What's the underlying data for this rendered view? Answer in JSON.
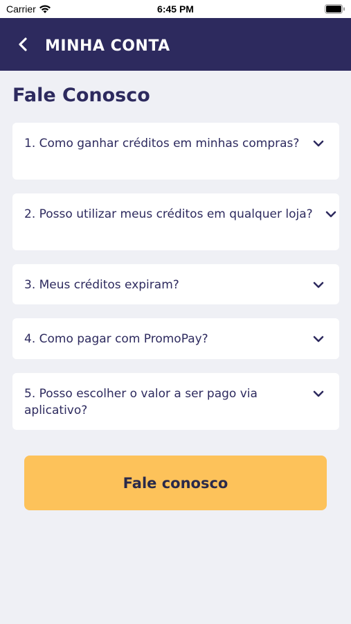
{
  "status_bar": {
    "carrier": "Carrier",
    "time": "6:45 PM"
  },
  "nav": {
    "title": "MINHA CONTA",
    "background_color": "#2d2a5e"
  },
  "page": {
    "title": "Fale Conosco"
  },
  "faq": [
    {
      "question": "1. Como ganhar créditos em minhas compras?"
    },
    {
      "question": "2. Posso utilizar meus créditos em qualquer loja?"
    },
    {
      "question": "3. Meus créditos expiram?"
    },
    {
      "question": "4. Como pagar com PromoPay?"
    },
    {
      "question": "5. Posso escolher o valor a ser pago via aplicativo?"
    }
  ],
  "cta": {
    "label": "Fale conosco",
    "color": "#fdc25a"
  },
  "icons": [
    "back-chevron-icon",
    "chevron-down-icon",
    "wifi-icon",
    "battery-icon"
  ]
}
